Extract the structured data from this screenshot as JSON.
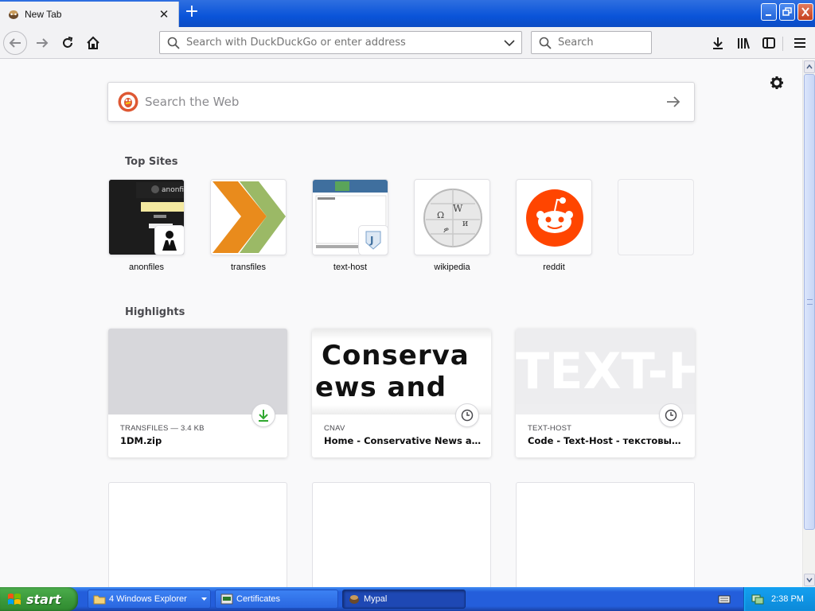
{
  "window": {
    "tab_title": "New Tab",
    "tab_close": "✕",
    "newtab_label": "+"
  },
  "toolbar": {
    "url_placeholder": "Search with DuckDuckGo or enter address",
    "search_placeholder": "Search"
  },
  "newtab": {
    "search_placeholder": "Search the Web",
    "top_sites_title": "Top Sites",
    "highlights_title": "Highlights",
    "top_sites": [
      {
        "label": "anonfiles"
      },
      {
        "label": "transfiles"
      },
      {
        "label": "text-host"
      },
      {
        "label": "wikipedia"
      },
      {
        "label": "reddit"
      },
      {
        "label": ""
      }
    ],
    "anonfiles_logo_text": "anonfiles",
    "highlights": [
      {
        "meta": "TRANSFILES — 3.4 KB",
        "title": "1DM.zip",
        "icon": "download-icon"
      },
      {
        "meta": "CNAV",
        "title": "Home - Conservative News and ...",
        "icon": "clock-icon",
        "preview_line1": "Conserva",
        "preview_line2": "ews and"
      },
      {
        "meta": "TEXT-HOST",
        "title": "Code - Text-Host - текстовый х...",
        "icon": "clock-icon",
        "preview_text": "TEXT-HOST"
      }
    ]
  },
  "taskbar": {
    "start_label": "start",
    "items": [
      {
        "label": "4 Windows Explorer"
      },
      {
        "label": "Certificates"
      },
      {
        "label": "Mypal"
      }
    ],
    "clock": "2:38 PM"
  },
  "colors": {
    "accent": "#0a84ff",
    "xp_blue": "#245edb",
    "start_green": "#3c9a3c",
    "reddit": "#ff4500",
    "download_green": "#30a830"
  }
}
